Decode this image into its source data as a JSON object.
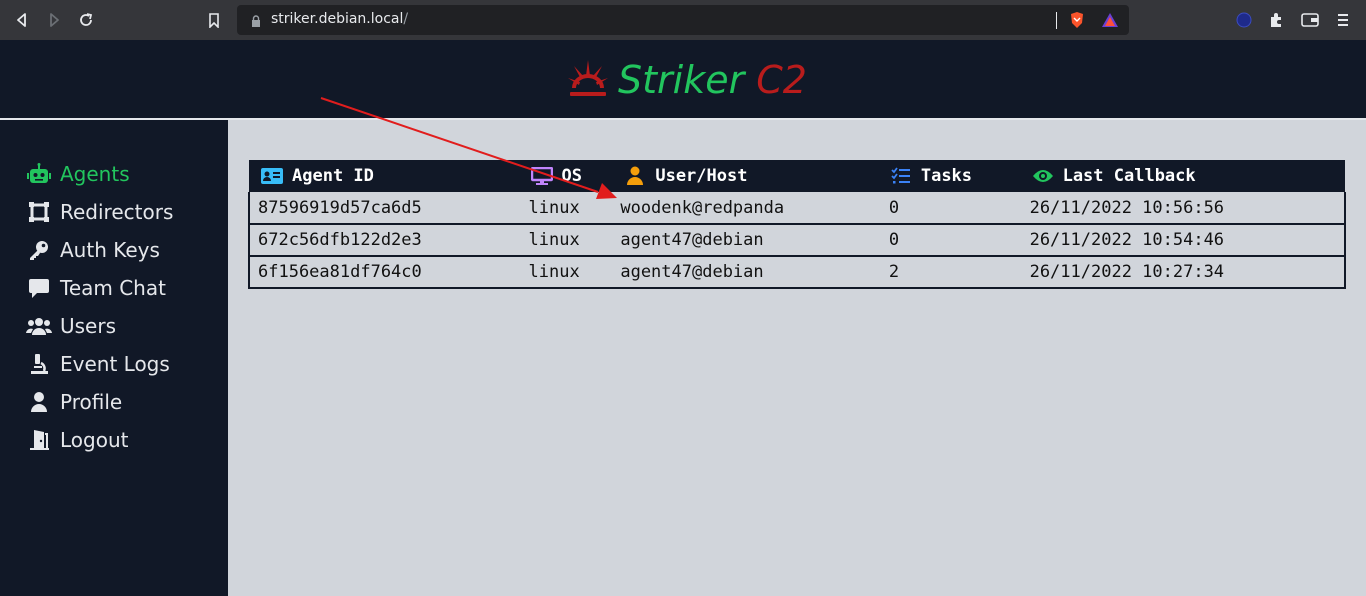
{
  "browser": {
    "url_host": "striker.debian.local",
    "url_path": "/"
  },
  "app": {
    "name": "Striker",
    "suffix": "C2"
  },
  "sidebar": {
    "items": [
      {
        "label": "Agents",
        "icon": "robot-icon",
        "active": true
      },
      {
        "label": "Redirectors",
        "icon": "redirect-icon"
      },
      {
        "label": "Auth Keys",
        "icon": "key-icon"
      },
      {
        "label": "Team Chat",
        "icon": "chat-icon"
      },
      {
        "label": "Users",
        "icon": "users-icon"
      },
      {
        "label": "Event Logs",
        "icon": "microscope-icon"
      },
      {
        "label": "Profile",
        "icon": "user-icon"
      },
      {
        "label": "Logout",
        "icon": "door-icon"
      }
    ]
  },
  "table": {
    "headers": {
      "agent_id": "Agent ID",
      "os": "OS",
      "user_host": "User/Host",
      "tasks": "Tasks",
      "last_callback": "Last Callback"
    },
    "rows": [
      {
        "agent_id": "87596919d57ca6d5",
        "os": "linux",
        "user_host": "woodenk@redpanda",
        "tasks": "0",
        "last_callback": "26/11/2022 10:56:56"
      },
      {
        "agent_id": "672c56dfb122d2e3",
        "os": "linux",
        "user_host": "agent47@debian",
        "tasks": "0",
        "last_callback": "26/11/2022 10:54:46"
      },
      {
        "agent_id": "6f156ea81df764c0",
        "os": "linux",
        "user_host": "agent47@debian",
        "tasks": "2",
        "last_callback": "26/11/2022 10:27:34"
      }
    ]
  },
  "colors": {
    "accent_green": "#22c55e",
    "accent_red": "#b91c1c",
    "dark": "#111827",
    "annotation_arrow": "#e11d1d"
  }
}
